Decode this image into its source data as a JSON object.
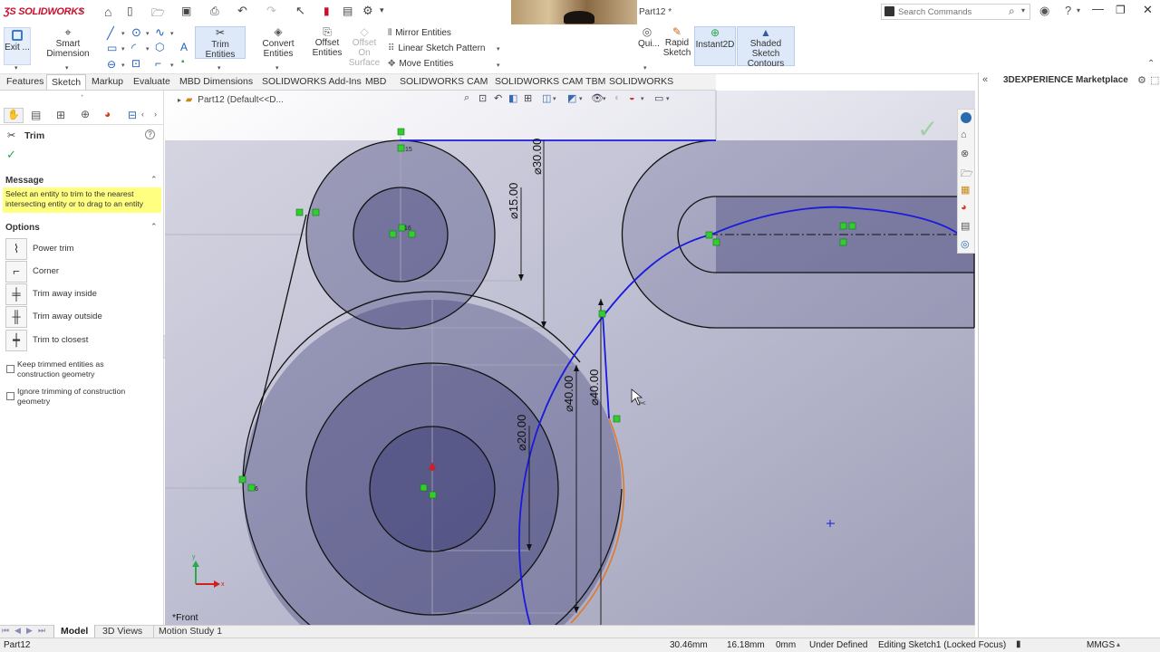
{
  "app": {
    "logo_text": "SOLIDWORKS",
    "doc_title": "Part12 *",
    "search_placeholder": "Search Commands"
  },
  "ribbon": {
    "exit_label": "Exit ...",
    "smart_dimension_label": "Smart Dimension",
    "trim_entities_label": "Trim Entities",
    "convert_entities_label": "Convert Entities",
    "offset_entities_label": "Offset Entities",
    "offset_on_surface_label": "Offset On Surface",
    "mirror_entities_label": "Mirror Entities",
    "linear_sketch_pattern_label": "Linear Sketch Pattern",
    "move_entities_label": "Move Entities",
    "quick_snaps_label": "Qui...",
    "rapid_sketch_label": "Rapid Sketch",
    "instant2d_label": "Instant2D",
    "shaded_sketch_contours_label": "Shaded Sketch Contours"
  },
  "tabs": [
    {
      "label": "Features"
    },
    {
      "label": "Sketch"
    },
    {
      "label": "Markup"
    },
    {
      "label": "Evaluate"
    },
    {
      "label": "MBD Dimensions"
    },
    {
      "label": "SOLIDWORKS Add-Ins"
    },
    {
      "label": "MBD"
    },
    {
      "label": "SOLIDWORKS CAM"
    },
    {
      "label": "SOLIDWORKS CAM TBM"
    },
    {
      "label": "SOLIDWORKS Inspection"
    }
  ],
  "property_manager": {
    "title": "Trim",
    "message_header": "Message",
    "message_text": "Select an entity to trim to the nearest intersecting entity or to drag to an entity",
    "options_header": "Options",
    "options": [
      {
        "label": "Power trim"
      },
      {
        "label": "Corner"
      },
      {
        "label": "Trim away inside"
      },
      {
        "label": "Trim away outside"
      },
      {
        "label": "Trim to closest"
      }
    ],
    "checkbox_keep_trimmed": "Keep trimmed entities as construction geometry",
    "checkbox_ignore_trimming": "Ignore trimming of construction geometry"
  },
  "canvas": {
    "tree_label": "Part12  (Default<<D...",
    "view_label": "*Front",
    "dimensions": {
      "d30": "⌀30.00",
      "d15": "⌀15.00",
      "d40a": "⌀40.00",
      "d40b": "⌀40.00",
      "d20": "⌀20.00"
    }
  },
  "right_panel": {
    "title": "3DEXPERIENCE Marketplace"
  },
  "bottom_tabs": [
    {
      "label": "Model"
    },
    {
      "label": "3D Views"
    },
    {
      "label": "Motion Study 1"
    }
  ],
  "status": {
    "doc_name": "Part12",
    "x_coord": "30.46mm",
    "y_coord": "16.18mm",
    "z_coord": "0mm",
    "definition": "Under Defined",
    "editing": "Editing Sketch1 (Locked Focus)",
    "units": "MMGS"
  },
  "colors": {
    "accent": "#c8102e",
    "sketch_blue": "#1a1adc",
    "message_bg": "#ffff80",
    "sketch_fill": "#9a9ab8"
  }
}
